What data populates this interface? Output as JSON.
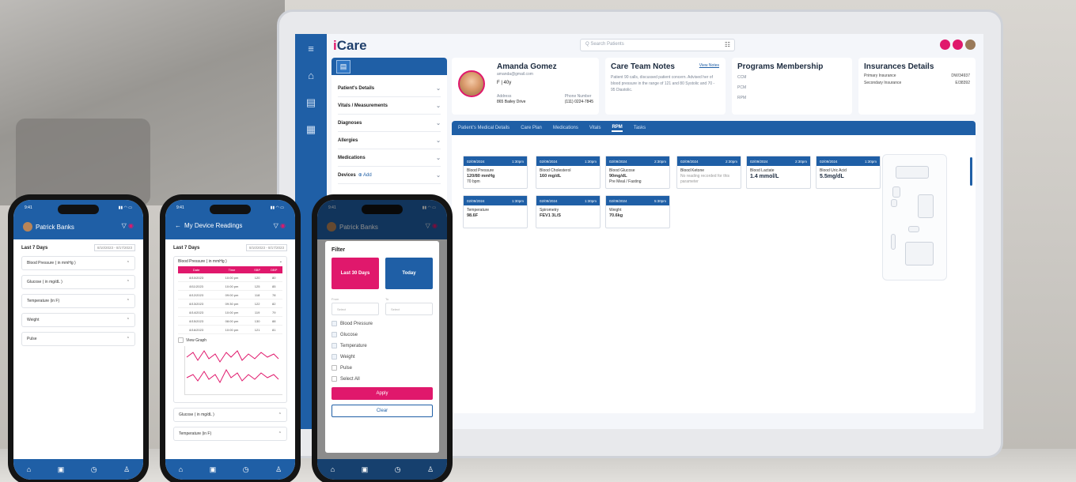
{
  "app": {
    "logo_prefix": "i",
    "logo_suffix": "Care",
    "search_placeholder": "Q Search Patients"
  },
  "left_panel": {
    "items": [
      {
        "label": "Patient's Details"
      },
      {
        "label": "Vitals / Measurements"
      },
      {
        "label": "Diagnoses"
      },
      {
        "label": "Allergies"
      },
      {
        "label": "Medications"
      },
      {
        "label": "Devices",
        "add": "⊕ Add"
      }
    ]
  },
  "patient": {
    "name": "Amanda Gomez",
    "email": "amanda@gmail.com",
    "sex_age": "F | 40y",
    "address_label": "Address",
    "address": "865 Bailey Drive",
    "phone_label": "Phone Number",
    "phone": "(111) 0224-7845"
  },
  "care_team": {
    "title": "Care Team Notes",
    "link": "View Notes",
    "text": "Patient 90 calls, discussed patient concern. Advised her of blood pressure in the range of 121 and 80 Systolic and 70 - 95 Diastolic."
  },
  "programs": {
    "title": "Programs Membership",
    "items": [
      "CCM",
      "PCM",
      "RPM"
    ]
  },
  "insurance": {
    "title": "Insurances Details",
    "rows": [
      {
        "label": "Primary Insurance",
        "value": "DW/34937"
      },
      {
        "label": "Secondary Insurance",
        "value": "E/38392"
      }
    ]
  },
  "tabs": [
    "Patient's Medical Details",
    "Care Plan",
    "Medications",
    "Vitals",
    "RPM",
    "Tasks"
  ],
  "active_tab": "RPM",
  "readings": [
    {
      "date": "02/09/2024",
      "time": "1:30pm",
      "label": "Blood Pressure",
      "value": "120/80 mmHg",
      "sub": "70 bpm"
    },
    {
      "date": "02/09/2024",
      "time": "1:30pm",
      "label": "Blood Cholesterol",
      "value": "160 mg/dL",
      "sub": ""
    },
    {
      "date": "02/09/2024",
      "time": "2:30pm",
      "label": "Blood Glucose",
      "value": "90mg/dL",
      "sub": "Pre Meal / Fasting"
    },
    {
      "date": "02/09/2024",
      "time": "2:30pm",
      "label": "Blood Ketone",
      "value": "",
      "sub": "No reading recorded for this parameter"
    },
    {
      "date": "02/09/2024",
      "time": "2:30pm",
      "label": "Blood Lactate",
      "value": "1.4 mmol/L",
      "sub": ""
    },
    {
      "date": "02/09/2024",
      "time": "1:30pm",
      "label": "Blood Uric Acid",
      "value": "5.5mg/dL",
      "sub": ""
    },
    {
      "date": "02/09/2024",
      "time": "1:30pm",
      "label": "Temperature",
      "value": "98.6F",
      "sub": ""
    },
    {
      "date": "02/09/2024",
      "time": "1:30pm",
      "label": "Spirometry",
      "value": "FEV1 3L/S",
      "sub": ""
    },
    {
      "date": "02/09/2024",
      "time": "5:30pm",
      "label": "Weight",
      "value": "70.6kg",
      "sub": ""
    }
  ],
  "phone1": {
    "status_time": "9:41",
    "title": "Patrick Banks",
    "period": "Last 7 Days",
    "range": "8/10/2023 - 8/17/2023",
    "items": [
      "Blood Pressure ( in mmHg )",
      "Glucose ( in mg/dL )",
      "Temperature (in F)",
      "Weight",
      "Pulse"
    ]
  },
  "phone2": {
    "status_time": "9:41",
    "title": "My Device Readings",
    "period": "Last 7 Days",
    "range": "8/10/2023 - 8/17/2023",
    "section": "Blood Pressure ( in mmHg )",
    "columns": [
      "Date",
      "Time",
      "SBP",
      "DBP"
    ],
    "rows": [
      [
        "8/10/2023",
        "10:00 pm",
        "120",
        "80"
      ],
      [
        "8/11/2023",
        "10:00 pm",
        "125",
        "85"
      ],
      [
        "8/12/2023",
        "09:00 pm",
        "118",
        "78"
      ],
      [
        "8/13/2023",
        "09:30 pm",
        "122",
        "82"
      ],
      [
        "8/14/2023",
        "10:00 pm",
        "119",
        "79"
      ],
      [
        "8/15/2023",
        "08:00 pm",
        "130",
        "88"
      ],
      [
        "8/16/2023",
        "10:00 pm",
        "121",
        "81"
      ]
    ],
    "view_graph": "View Graph",
    "bottom_items": [
      "Glucose ( in mg/dL )",
      "Temperature (in F)"
    ]
  },
  "phone3": {
    "status_time": "9:41",
    "title": "Patrick Banks",
    "filter_title": "Filter",
    "btn_last30": "Last 30 Days",
    "btn_today": "Today",
    "from_label": "From",
    "to_label": "To",
    "from_placeholder": "Select",
    "to_placeholder": "Select",
    "options": [
      "Blood Pressure",
      "Glucose",
      "Temperature",
      "Weight",
      "Pulse",
      "Select All"
    ],
    "apply": "Apply",
    "clear": "Clear"
  },
  "colors": {
    "primary": "#1f5fa6",
    "accent": "#e0186c"
  }
}
